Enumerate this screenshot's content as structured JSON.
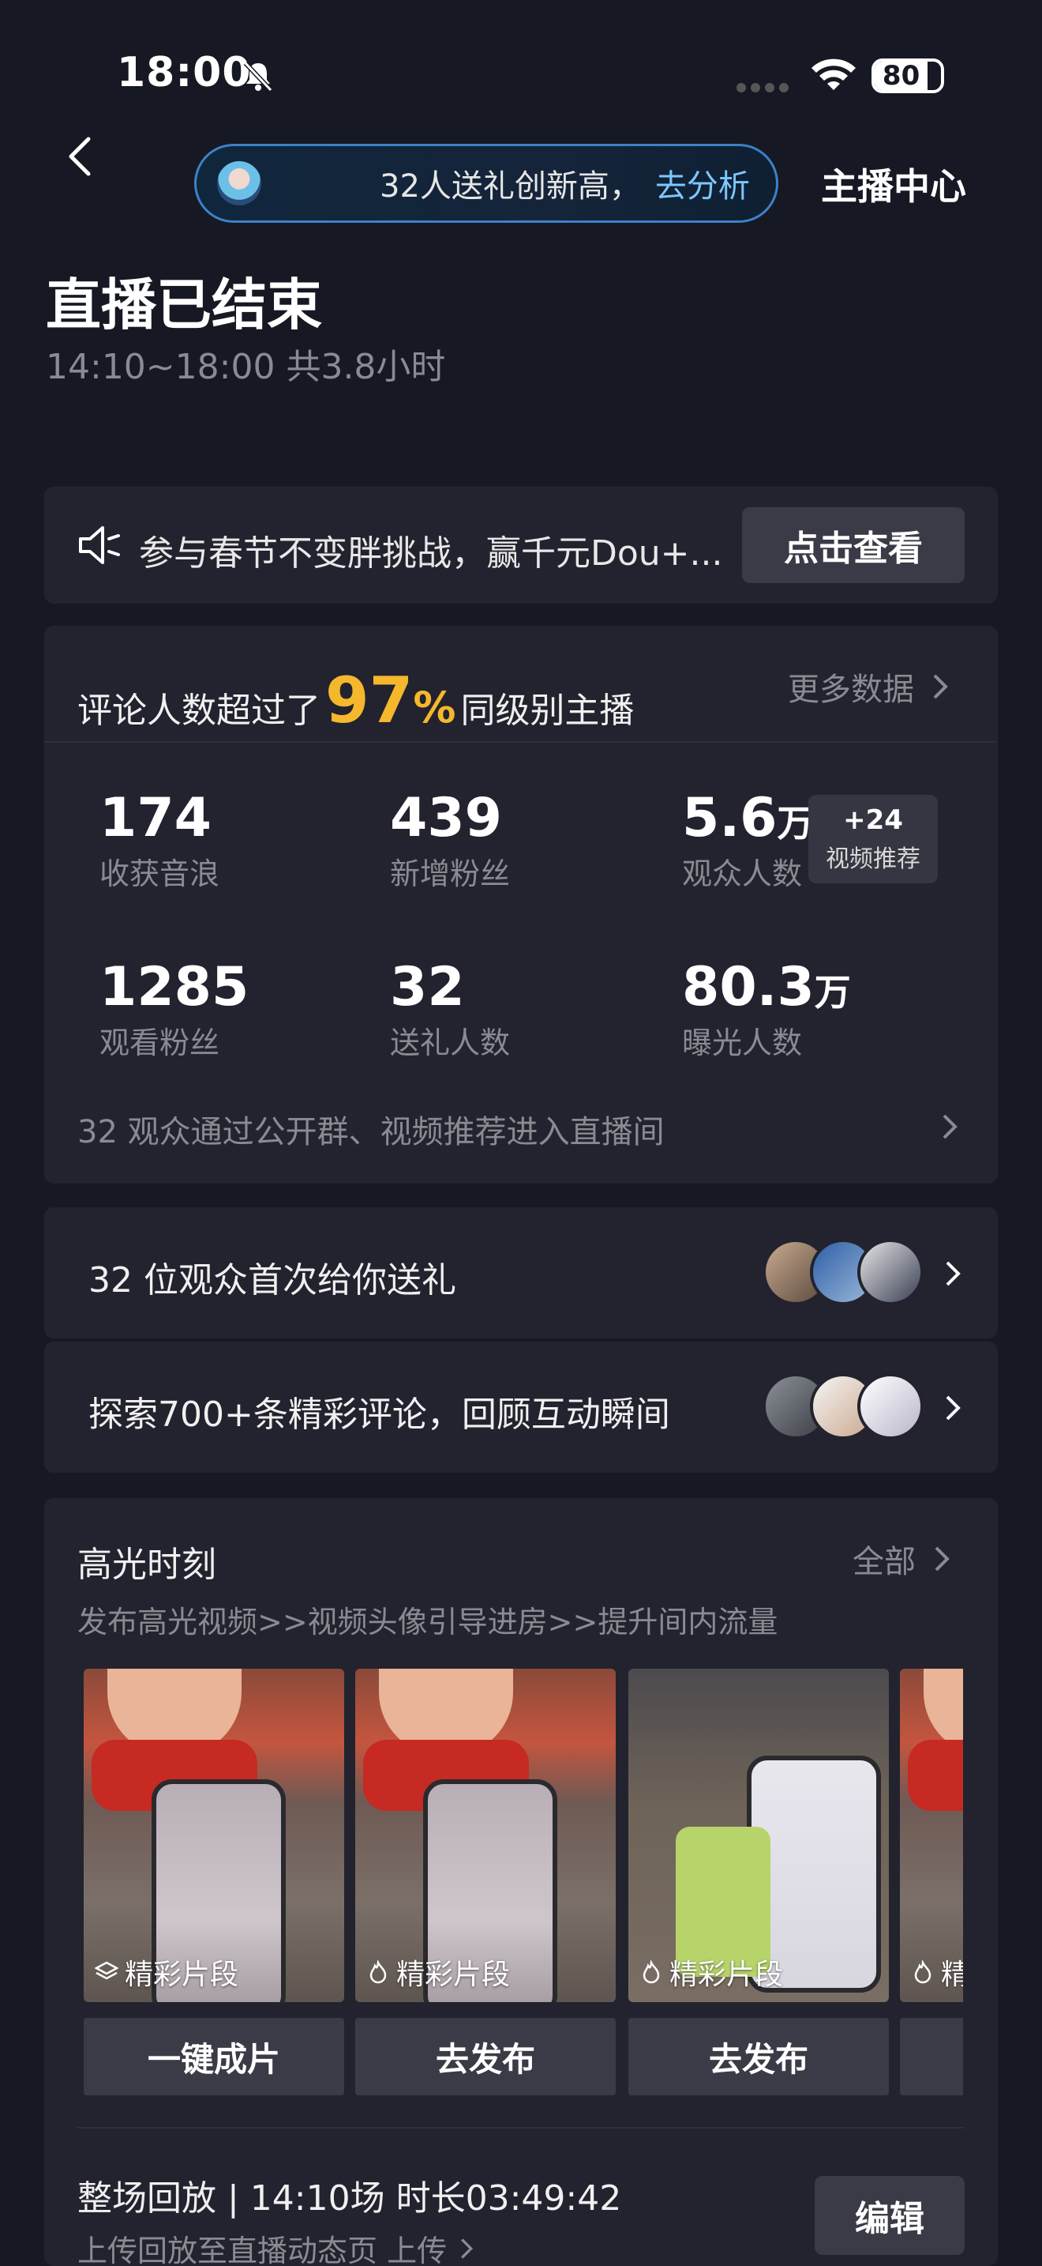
{
  "status_bar": {
    "time": "18:00",
    "battery": "80"
  },
  "header": {
    "pill_message": "32人送礼创新高，",
    "pill_link": "去分析",
    "anchor_center": "主播中心"
  },
  "summary": {
    "title": "直播已结束",
    "subtitle": "14:10~18:00 共3.8小时"
  },
  "notice": {
    "text": "参与春节不变胖挑战，赢千元Dou+...",
    "button": "点击查看"
  },
  "ranking": {
    "prefix": "评论人数超过了",
    "percent": "97",
    "percent_sign": "%",
    "suffix": "同级别主播",
    "more": "更多数据"
  },
  "stats": [
    {
      "value": "174",
      "unit": "",
      "label": "收获音浪"
    },
    {
      "value": "439",
      "unit": "",
      "label": "新增粉丝"
    },
    {
      "value": "5.6",
      "unit": "万",
      "label": "观众人数"
    },
    {
      "value": "1285",
      "unit": "",
      "label": "观看粉丝"
    },
    {
      "value": "32",
      "unit": "",
      "label": "送礼人数"
    },
    {
      "value": "80.3",
      "unit": "万",
      "label": "曝光人数"
    }
  ],
  "recommend_badge": {
    "count": "+24",
    "label": "视频推荐"
  },
  "entry_info": "32 观众通过公开群、视频推荐进入直播间",
  "rows": [
    {
      "text": "32 位观众首次给你送礼"
    },
    {
      "text": "探索700+条精彩评论，回顾互动瞬间"
    }
  ],
  "highlights": {
    "title": "高光时刻",
    "all": "全部",
    "subtitle": "发布高光视频>>视频头像引导进房>>提升间内流量",
    "clips": [
      {
        "tag": "精彩片段",
        "button": "一键成片"
      },
      {
        "tag": "精彩片段",
        "button": "去发布"
      },
      {
        "tag": "精彩片段",
        "button": "去发布"
      },
      {
        "tag": "精",
        "button": ""
      }
    ]
  },
  "replay": {
    "title": "整场回放 | 14:10场 时长03:49:42",
    "subtitle": "上传回放至直播动态页 上传",
    "edit": "编辑"
  },
  "colors": {
    "accent": "#f5b72c",
    "background": "#161823",
    "card": "#22232e",
    "link": "#7cc8ff"
  }
}
